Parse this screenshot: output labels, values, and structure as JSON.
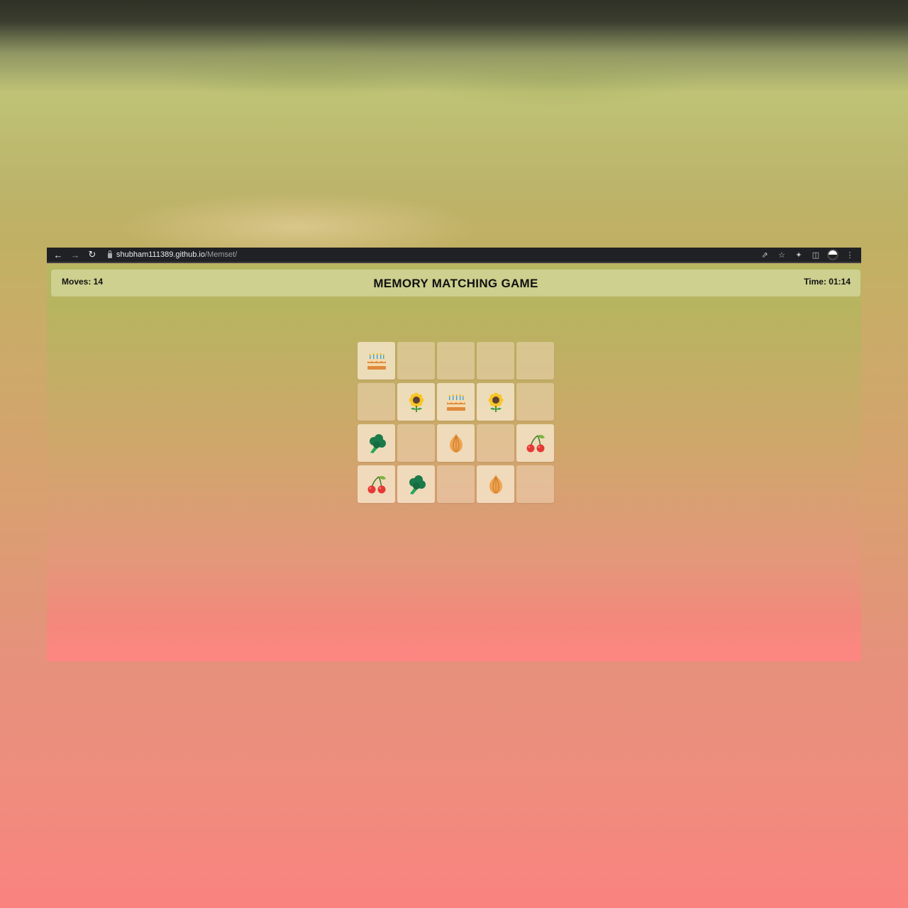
{
  "browser": {
    "url_host": "shubham111389.github.io",
    "url_path": "/Memset/"
  },
  "game": {
    "moves_label": "Moves: 14",
    "title": "MEMORY MATCHING GAME",
    "time_label": "Time: 01:14",
    "cards": [
      {
        "icon": "cake-icon",
        "open": true
      },
      {
        "icon": "",
        "open": false
      },
      {
        "icon": "",
        "open": false
      },
      {
        "icon": "",
        "open": false
      },
      {
        "icon": "",
        "open": false
      },
      {
        "icon": "",
        "open": false
      },
      {
        "icon": "sunflower-icon",
        "open": true
      },
      {
        "icon": "cake-icon",
        "open": true
      },
      {
        "icon": "sunflower-icon",
        "open": true
      },
      {
        "icon": "",
        "open": false
      },
      {
        "icon": "broccoli-icon",
        "open": true
      },
      {
        "icon": "",
        "open": false
      },
      {
        "icon": "onion-icon",
        "open": true
      },
      {
        "icon": "",
        "open": false
      },
      {
        "icon": "cherry-icon",
        "open": true
      },
      {
        "icon": "cherry-icon",
        "open": true
      },
      {
        "icon": "broccoli-icon",
        "open": true
      },
      {
        "icon": "",
        "open": false
      },
      {
        "icon": "onion-icon",
        "open": true
      },
      {
        "icon": "",
        "open": false
      }
    ]
  },
  "colors": {
    "cherry": "#e53935",
    "cherry_stem": "#7cb342",
    "broccoli": "#1b7a4a",
    "broccoli_stem": "#26a65b",
    "onion": "#f0a552",
    "sunflower_petal": "#f9c623",
    "sunflower_center": "#5d4037",
    "cake": "#e08a3c",
    "cake_cream": "#f6d9a8"
  }
}
